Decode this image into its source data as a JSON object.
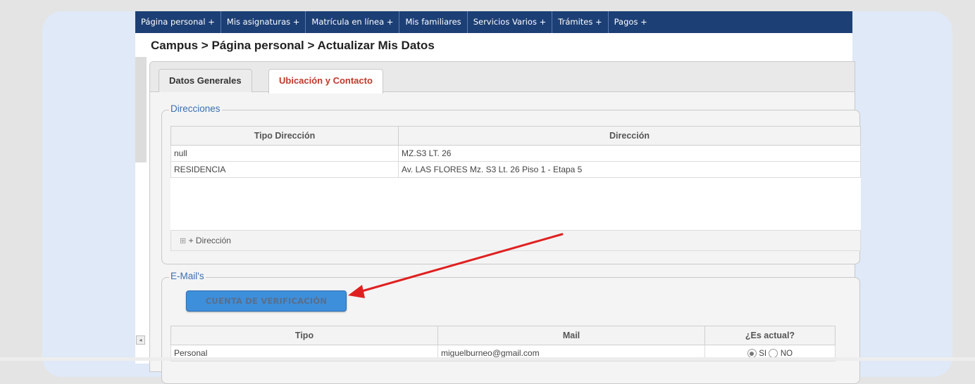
{
  "nav": {
    "items": [
      {
        "label": "Página personal +"
      },
      {
        "label": "Mis asignaturas +"
      },
      {
        "label": "Matrícula en línea +"
      },
      {
        "label": "Mis familiares"
      },
      {
        "label": "Servicios Varios +"
      },
      {
        "label": "Trámites +"
      },
      {
        "label": "Pagos +"
      }
    ]
  },
  "breadcrumb": "Campus > Página personal > Actualizar Mis Datos",
  "tabs": [
    {
      "label": "Datos Generales"
    },
    {
      "label": "Ubicación y Contacto"
    }
  ],
  "direcciones": {
    "legend": "Direcciones",
    "headers": [
      "Tipo Dirección",
      "Dirección"
    ],
    "rows": [
      {
        "tipo": "null",
        "direccion": "MZ.S3 LT. 26"
      },
      {
        "tipo": "RESIDENCIA",
        "direccion": "Av. LAS FLORES Mz. S3 Lt. 26 Piso 1 - Etapa 5"
      }
    ],
    "add_label": "+ Dirección"
  },
  "emails": {
    "legend": "E-Mail's",
    "verify_button": "CUENTA DE VERIFICACIÓN",
    "headers": [
      "Tipo",
      "Mail",
      "¿Es actual?"
    ],
    "rows": [
      {
        "tipo": "Personal",
        "mail": "miguelburneo@gmail.com",
        "si": "SI",
        "no": "NO",
        "actual": "SI"
      }
    ]
  },
  "colors": {
    "nav_bg": "#1c3f75",
    "accent_tab": "#c0392b",
    "legend": "#3a6fb2",
    "arrow": "#e02020",
    "button": "#3d8fdb"
  }
}
